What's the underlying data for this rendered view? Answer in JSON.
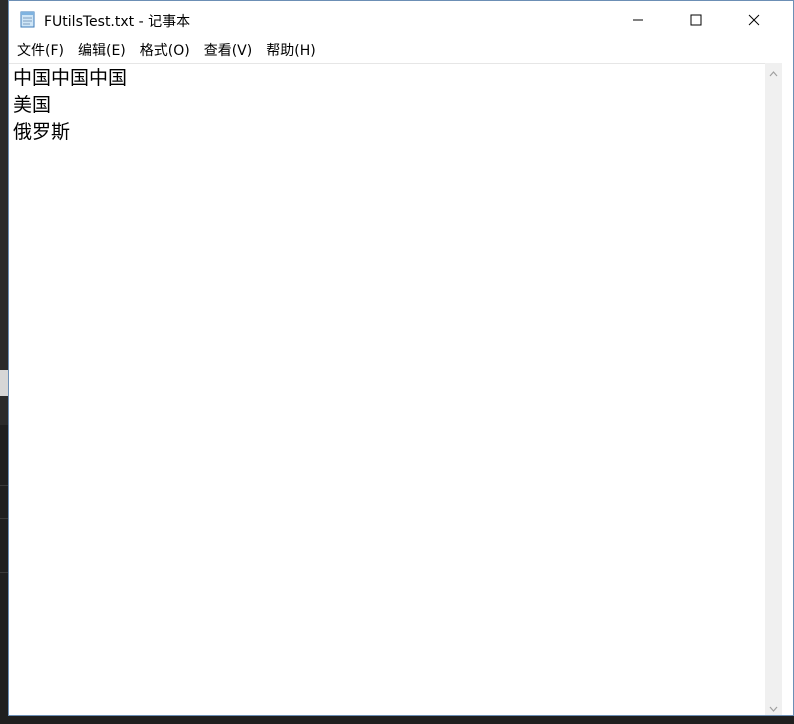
{
  "window": {
    "title": "FUtilsTest.txt - 记事本",
    "icon": "notepad-icon",
    "controls": {
      "minimize_icon": "minimize-icon",
      "maximize_icon": "maximize-icon",
      "close_icon": "close-icon"
    }
  },
  "menubar": {
    "items": [
      {
        "label": "文件(F)"
      },
      {
        "label": "编辑(E)"
      },
      {
        "label": "格式(O)"
      },
      {
        "label": "查看(V)"
      },
      {
        "label": "帮助(H)"
      }
    ]
  },
  "editor": {
    "lines": [
      "中国中国中国",
      "美国",
      "俄罗斯"
    ]
  },
  "colors": {
    "window_border": "#6c8fb5",
    "scrollbar_bg": "#f0f0f0",
    "text": "#000000"
  }
}
